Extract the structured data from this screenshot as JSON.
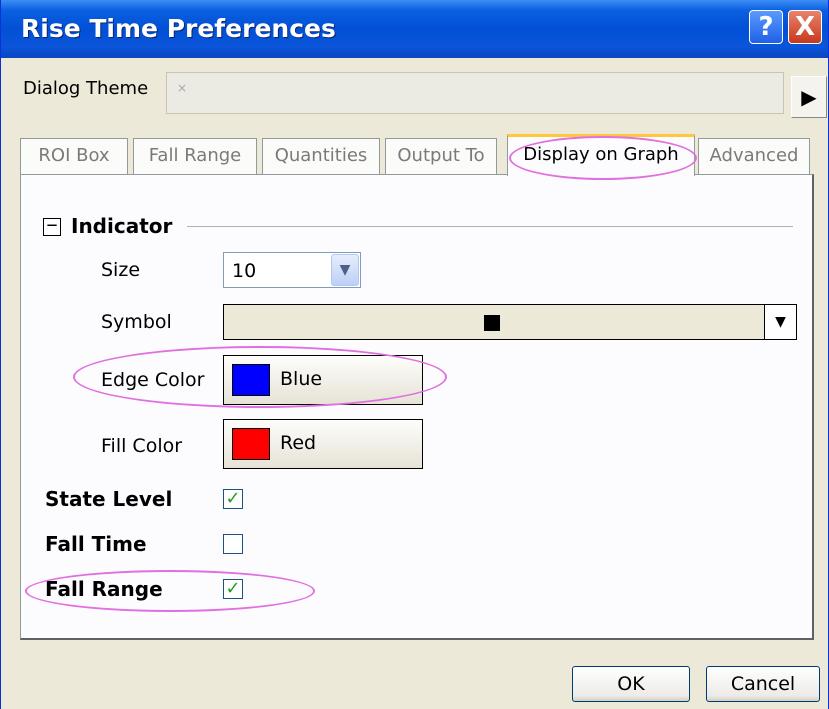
{
  "window": {
    "title": "Rise Time Preferences",
    "help_label": "?",
    "close_label": "X"
  },
  "theme": {
    "label": "Dialog Theme",
    "value": "×",
    "arrow": "▶"
  },
  "tabs": [
    {
      "label": "ROI Box",
      "active": false
    },
    {
      "label": "Fall Range",
      "active": false
    },
    {
      "label": "Quantities",
      "active": false
    },
    {
      "label": "Output To",
      "active": false
    },
    {
      "label": "Display on Graph",
      "active": true
    },
    {
      "label": "Advanced",
      "active": false
    }
  ],
  "indicator": {
    "collapse_glyph": "−",
    "title": "Indicator",
    "size": {
      "label": "Size",
      "value": "10",
      "drop_glyph": "▼"
    },
    "symbol": {
      "label": "Symbol",
      "drop_glyph": "▼"
    },
    "edge_color": {
      "label": "Edge Color",
      "value": "Blue",
      "swatch": "#0000ff"
    },
    "fill_color": {
      "label": "Fill Color",
      "value": "Red",
      "swatch": "#ff0000"
    }
  },
  "options": {
    "state_level": {
      "label": "State Level",
      "checked": true,
      "mark": "✓"
    },
    "fall_time": {
      "label": "Fall Time",
      "checked": false,
      "mark": ""
    },
    "fall_range": {
      "label": "Fall Range",
      "checked": true,
      "mark": "✓"
    }
  },
  "buttons": {
    "ok": "OK",
    "cancel": "Cancel"
  },
  "colors": {
    "title_bar": "#0150d6",
    "highlight_ring": "#e070e0",
    "active_tab_top": "#ffc83c"
  }
}
